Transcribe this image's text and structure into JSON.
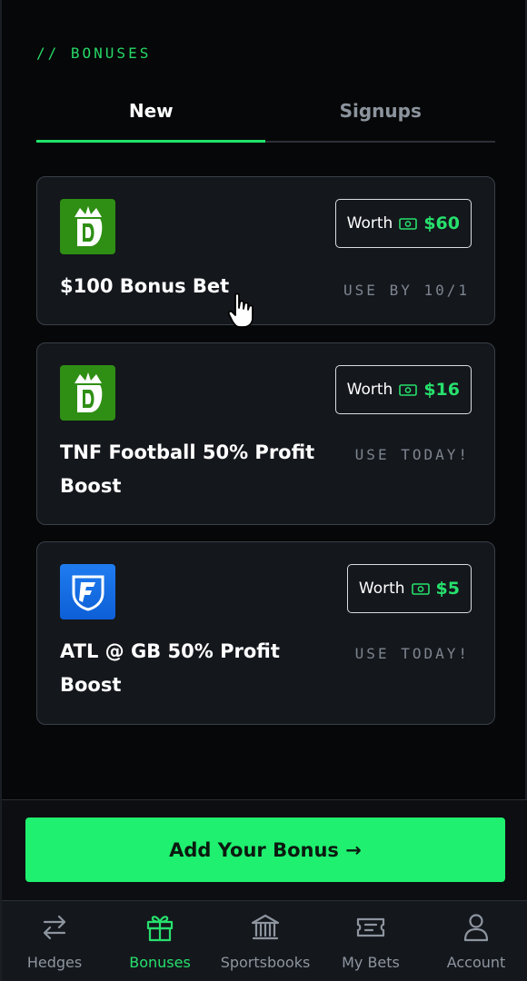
{
  "section_label": "// BONUSES",
  "tabs": [
    {
      "label": "New",
      "active": true
    },
    {
      "label": "Signups",
      "active": false
    }
  ],
  "bonuses": [
    {
      "sportsbook_icon": "draftkings-logo-icon",
      "worth_label": "Worth",
      "worth_amount": "$60",
      "title": "$100 Bonus Bet",
      "expiry": "USE BY 10/1"
    },
    {
      "sportsbook_icon": "draftkings-logo-icon",
      "worth_label": "Worth",
      "worth_amount": "$16",
      "title": "TNF Football 50% Profit Boost",
      "expiry": "USE TODAY!"
    },
    {
      "sportsbook_icon": "fanduel-logo-icon",
      "worth_label": "Worth",
      "worth_amount": "$5",
      "title": "ATL @ GB 50% Profit Boost",
      "expiry": "USE TODAY!"
    }
  ],
  "cta": {
    "label": "Add Your Bonus →"
  },
  "nav": [
    {
      "label": "Hedges",
      "icon": "arrows-swap-icon",
      "active": false
    },
    {
      "label": "Bonuses",
      "icon": "gift-icon",
      "active": true
    },
    {
      "label": "Sportsbooks",
      "icon": "bank-icon",
      "active": false
    },
    {
      "label": "My Bets",
      "icon": "ticket-icon",
      "active": false
    },
    {
      "label": "Account",
      "icon": "user-icon",
      "active": false
    }
  ],
  "colors": {
    "accent": "#1ff06f",
    "background": "#060708",
    "card": "#14171c"
  }
}
